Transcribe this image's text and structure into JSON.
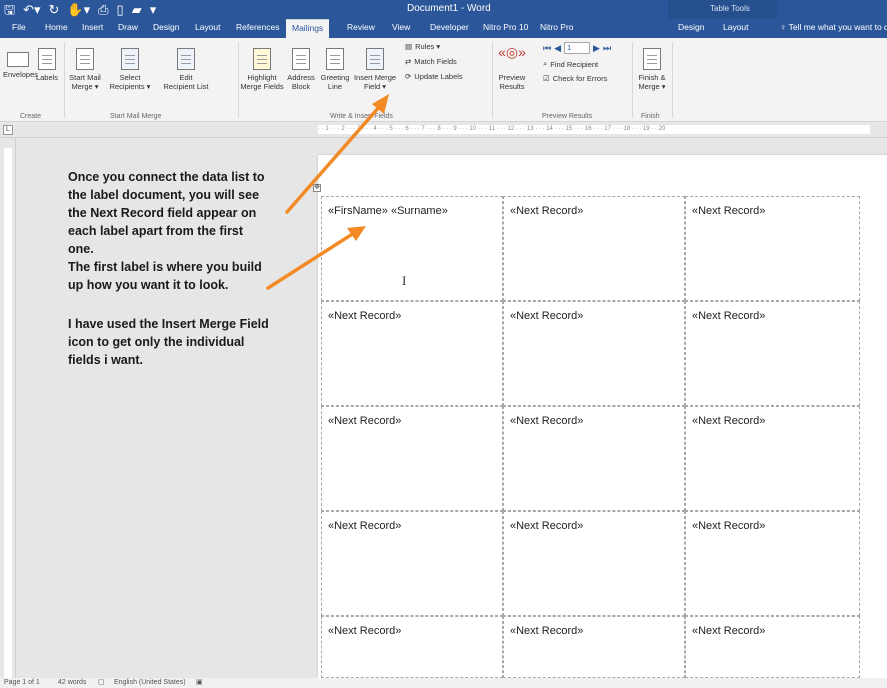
{
  "titlebar": {
    "document_title": "Document1 - Word",
    "context_group": "Table Tools",
    "qat_icons": [
      "save-icon",
      "undo-icon",
      "redo-icon",
      "touch-mode-icon",
      "print-preview-icon",
      "new-document-icon",
      "open-icon",
      "customize-icon"
    ]
  },
  "tabs": {
    "file": "File",
    "home": "Home",
    "insert": "Insert",
    "draw": "Draw",
    "design": "Design",
    "layout": "Layout",
    "references": "References",
    "mailings": "Mailings",
    "review": "Review",
    "view": "View",
    "developer": "Developer",
    "nitro10": "Nitro Pro 10",
    "nitro": "Nitro Pro",
    "table_design": "Design",
    "table_layout": "Layout",
    "tell_me": "Tell me what you want to d"
  },
  "ribbon": {
    "envelopes": "Envelopes",
    "labels": "Labels",
    "start_mail_merge_1": "Start Mail",
    "start_mail_merge_2": "Merge ▾",
    "select_recipients_1": "Select",
    "select_recipients_2": "Recipients ▾",
    "edit_list_1": "Edit",
    "edit_list_2": "Recipient List",
    "highlight_1": "Highlight",
    "highlight_2": "Merge Fields",
    "address_1": "Address",
    "address_2": "Block",
    "greeting_1": "Greeting",
    "greeting_2": "Line",
    "insert_field_1": "Insert Merge",
    "insert_field_2": "Field ▾",
    "rules": "Rules ▾",
    "match_fields": "Match Fields",
    "update_labels": "Update Labels",
    "preview_1": "Preview",
    "preview_2": "Results",
    "record_number": "1",
    "find_recipient": "Find Recipient",
    "check_errors": "Check for Errors",
    "finish_1": "Finish &",
    "finish_2": "Merge ▾",
    "group_create": "Create",
    "group_start": "Start Mail Merge",
    "group_write": "Write & Insert Fields",
    "group_preview": "Preview Results",
    "group_finish": "Finish"
  },
  "ruler": {
    "marks": "· · 1 · · · 2 · · · 3 · · · 4 · · · 5 · · · 6 · · · 7 · · · 8 · · · 9 · · · 10 · · · 11 · · · 12 · · · 13 · · · 14 · · · 15 · · · 16 · · · 17 · · · 18 · · · 19 · · 20"
  },
  "annotation": {
    "para1_line1": "Once you connect the data list to",
    "para1_line2": "the label document, you will see",
    "para1_line3": "the Next Record field appear on",
    "para1_line4": "each label apart from the first",
    "para1_line5": "one.",
    "para1_line6": "The first label is where you build",
    "para1_line7": "up how you want it to look.",
    "para2_line1": "I have used the Insert Merge Field",
    "para2_line2": "icon to get only the individual",
    "para2_line3": "fields i want."
  },
  "labels": {
    "first": "«FirsName» «Surname»",
    "next": "«Next Record»"
  },
  "statusbar": {
    "page": "Page 1 of 1",
    "words": "42 words",
    "language": "English (United States)"
  },
  "colors": {
    "word_blue": "#2b579a",
    "arrow_orange": "#f28a26"
  }
}
